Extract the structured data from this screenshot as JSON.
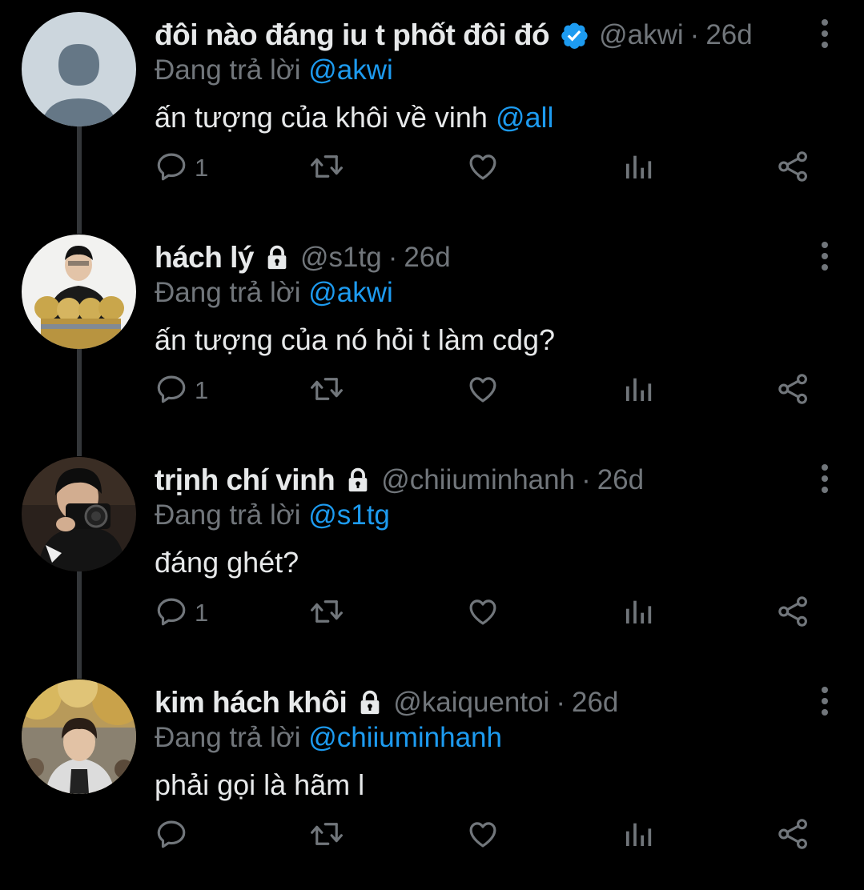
{
  "colors": {
    "background": "#000000",
    "text": "#e7e9ea",
    "secondary": "#71767b",
    "accent": "#1d9bf0",
    "thread_line": "#333639"
  },
  "icons": [
    "more-vertical-icon",
    "reply-icon",
    "retweet-icon",
    "like-icon",
    "analytics-icon",
    "share-icon",
    "verified-badge-icon",
    "lock-icon"
  ],
  "tweets": [
    {
      "name": "đôi nào đáng iu t phốt đôi đó",
      "badge": "verified",
      "handle": "@akwi",
      "dot": "·",
      "time": "26d",
      "reply_prefix": "Đang trả lời",
      "reply_to": "@akwi",
      "text": "ấn tượng của khôi về vinh",
      "text_mention": "@all",
      "reply_count": "1"
    },
    {
      "name": "hách lý",
      "badge": "lock",
      "handle": "@s1tg",
      "dot": "·",
      "time": "26d",
      "reply_prefix": "Đang trả lời",
      "reply_to": "@akwi",
      "text": "ấn tượng của nó hỏi t làm cdg?",
      "text_mention": "",
      "reply_count": "1"
    },
    {
      "name": "trịnh chí vinh",
      "badge": "lock",
      "handle": "@chiiuminhanh",
      "dot": "·",
      "time": "26d",
      "reply_prefix": "Đang trả lời",
      "reply_to": "@s1tg",
      "text": "đáng ghét?",
      "text_mention": "",
      "reply_count": "1"
    },
    {
      "name": "kim hách khôi",
      "badge": "lock",
      "handle": "@kaiquentoi",
      "dot": "·",
      "time": "26d",
      "reply_prefix": "Đang trả lời",
      "reply_to": "@chiiuminhanh",
      "text": "phải gọi là hãm l",
      "text_mention": "",
      "reply_count": ""
    }
  ]
}
